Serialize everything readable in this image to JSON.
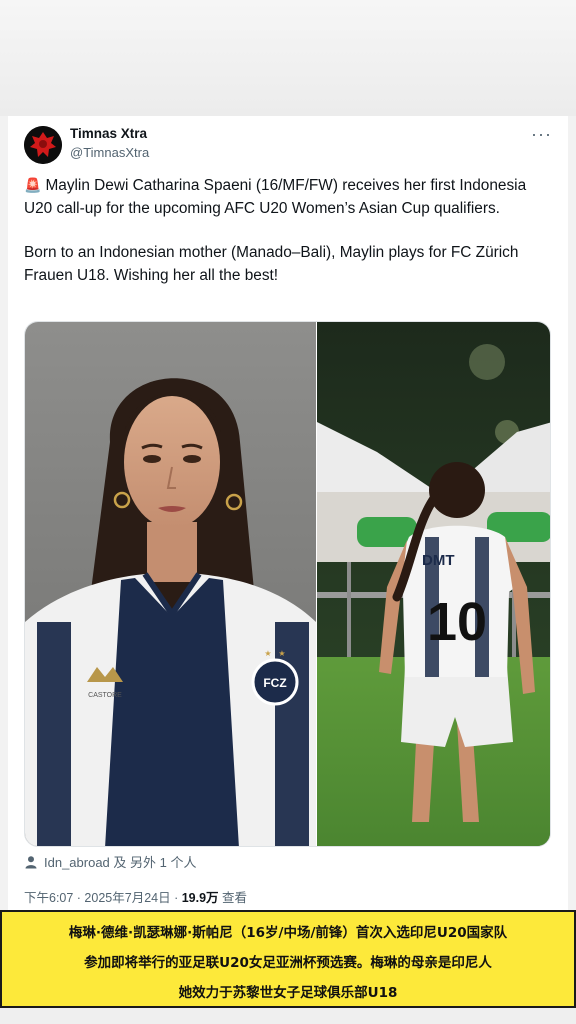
{
  "tweet": {
    "author_name": "Timnas Xtra",
    "author_handle": "@TimnasXtra",
    "more_label": "···",
    "siren_emoji": "🚨",
    "paragraph_1": "Maylin Dewi Catharina Spaeni (16/MF/FW) receives her first Indonesia U20 call-up for the upcoming AFC U20 Women’s Asian Cup qualifiers.",
    "paragraph_2": "Born to an Indonesian mother (Manado–Bali), Maylin plays for FC Zürich Frauen U18. Wishing her all the best!",
    "tagged": "Idn_abroad 及 另外 1 个人",
    "time": "下午6:07 · 2025年7月24日 · ",
    "views_count": "19.9万",
    "views_label": " 查看",
    "jersey_number": "10",
    "jersey_sponsor": "DMT",
    "crest_text": "FCZ",
    "shirt_brand": "CASTORE"
  },
  "caption": {
    "line_1": "梅琳·德维·凯瑟琳娜·斯帕尼（16岁/中场/前锋）首次入选印尼U20国家队",
    "line_2": "参加即将举行的亚足联U20女足亚洲杯预选赛。梅琳的母亲是印尼人",
    "line_3": "她效力于苏黎世女子足球俱乐部U18"
  },
  "colors": {
    "caption_bg": "#fde93a",
    "secondary_text": "#536471",
    "jersey_navy": "#1c2b4a"
  }
}
